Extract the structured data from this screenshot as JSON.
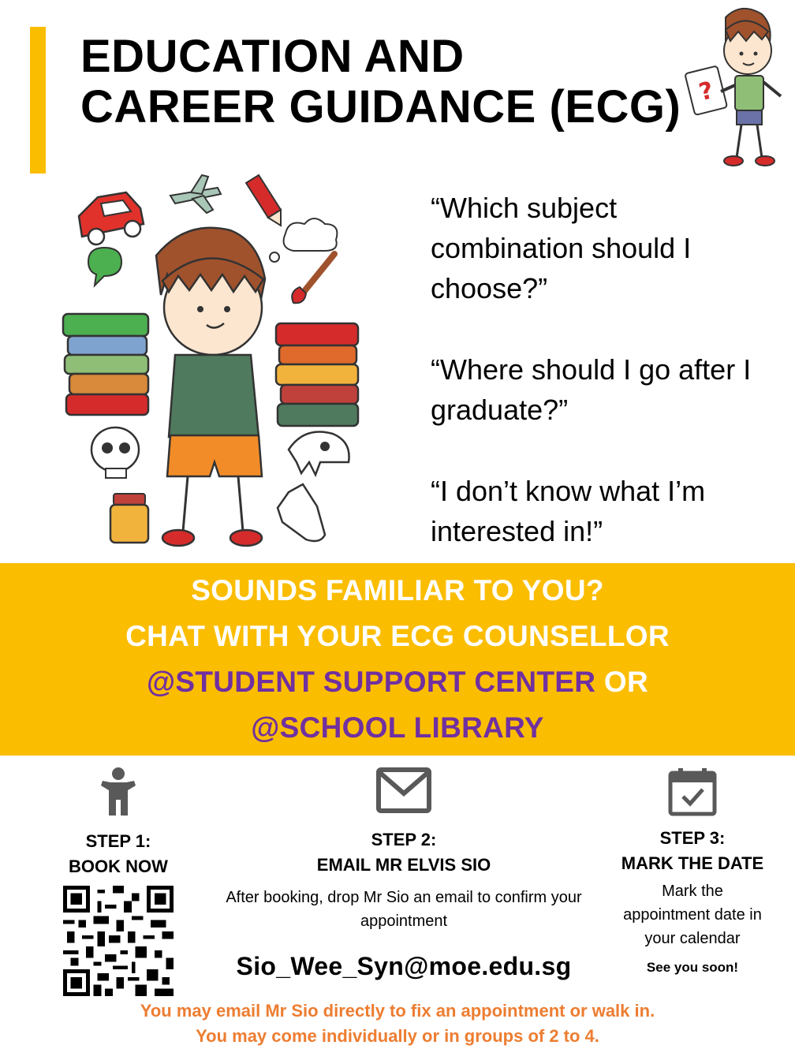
{
  "header": {
    "title_line1": "EDUCATION AND",
    "title_line2": "CAREER GUIDANCE (ECG)"
  },
  "questions": [
    "“Which subject combination should I choose?”",
    "“Where should I go after I graduate?”",
    "“I don’t know what I’m interested in!”"
  ],
  "banner": {
    "line1": "SOUNDS FAMILIAR TO YOU?",
    "line2": "CHAT WITH YOUR ECG COUNSELLOR",
    "line3_place": "@STUDENT SUPPORT CENTER",
    "line3_or": " OR",
    "line4_place": "@SCHOOL LIBRARY"
  },
  "steps": [
    {
      "title_line1": "STEP 1:",
      "title_line2": "BOOK NOW",
      "icon": "person-icon"
    },
    {
      "title_line1": "STEP 2:",
      "title_line2": "EMAIL MR ELVIS SIO",
      "icon": "envelope-icon",
      "description": "After booking, drop Mr Sio an email to confirm your appointment",
      "email": "Sio_Wee_Syn@moe.edu.sg"
    },
    {
      "title_line1": "STEP 3:",
      "title_line2": "MARK THE DATE",
      "icon": "calendar-check-icon",
      "description": "Mark the appointment date in your calendar",
      "closing": "See you soon!"
    }
  ],
  "footer": {
    "line1": "You may email Mr Sio directly to fix an appointment or walk in.",
    "line2": "You may come individually or in groups of 2 to 4."
  },
  "colors": {
    "accent": "#fbbd00",
    "purple": "#7030a0",
    "orange": "#ed7d31",
    "icon_gray": "#595959"
  }
}
